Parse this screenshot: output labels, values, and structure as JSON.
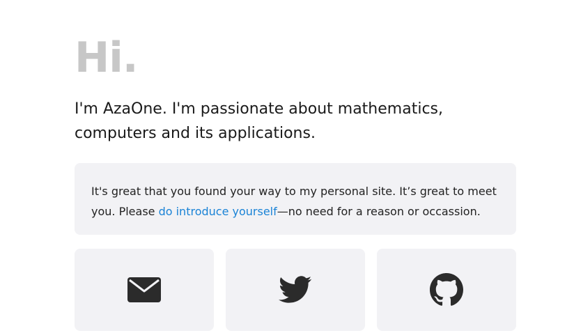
{
  "greeting": "Hi.",
  "lead": "I'm AzaOne. I'm passionate about mathematics, computers and its applications.",
  "intro": {
    "before_link": "It's great that you found your way to my personal site. It’s great to meet you. Please ",
    "link_text": "do introduce yourself",
    "after_link": "—no need for a reason or occassion."
  },
  "social": [
    {
      "icon": "envelope-icon"
    },
    {
      "icon": "twitter-bird-icon"
    },
    {
      "icon": "github-octocat-icon"
    }
  ],
  "colors": {
    "greeting": "#c7c7c7",
    "text": "#1a1a1a",
    "link": "#1a83d6",
    "card_background": "#f2f2f5",
    "icon": "#2b2b2b"
  }
}
